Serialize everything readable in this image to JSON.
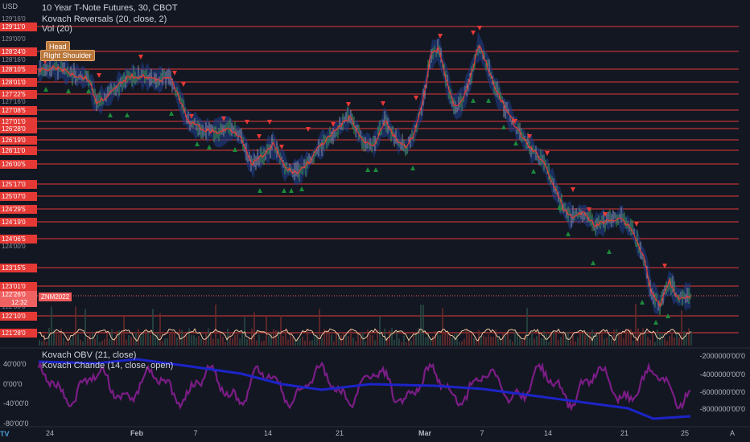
{
  "currency": "USD",
  "brand_mark": "TV",
  "legend": {
    "title": "10 Year T-Note Futures, 30, CBOT",
    "reversals": "Kovach Reversals (20, close, 2)",
    "vol": "Vol (20)"
  },
  "annotations": {
    "head": "Head",
    "right_shoulder": "Right Shoulder"
  },
  "symbol_tag": "ZNM2022",
  "current_price": {
    "price": "122'26'0",
    "countdown": "12:32"
  },
  "level_labels": [
    "129'11'0",
    "128'24'0",
    "128'10'5",
    "128'01'0",
    "127'22'5",
    "127'08'5",
    "127'01'0",
    "126'28'0",
    "126'19'0",
    "126'11'0",
    "126'00'5",
    "125'17'0",
    "125'07'0",
    "124'29'5",
    "124'19'0",
    "124'06'5",
    "123'15'5",
    "123'01'0",
    "122'10'0",
    "121'28'0"
  ],
  "grey_ticks": [
    "129'16'0",
    "129'00'0",
    "128'16'0",
    "127'16'0",
    "124'00'0",
    "122'16'0",
    "122'00'0"
  ],
  "osc": {
    "obv_label": "Kovach OBV (21, close)",
    "chande_label": "Kovach Chande (14, close, open)",
    "left_ticks": [
      "40'00'0",
      "0'00'0",
      "-40'00'0",
      "-80'00'0"
    ],
    "right_ticks": [
      "-2000000'00'0",
      "-4000000'00'0",
      "-6000000'00'0",
      "-8000000'00'0"
    ]
  },
  "x_axis": [
    "24",
    "Feb",
    "7",
    "14",
    "21",
    "Mar",
    "7",
    "14",
    "21",
    "25"
  ],
  "auto_label": "A",
  "colors": {
    "background": "#131722",
    "level_line": "#e53935",
    "price_line": "#e53935",
    "bull_marker": "#1b8a3a",
    "bear_marker": "#e53935",
    "obv_line": "#1c24c8",
    "chande_line": "#7b1d86"
  }
}
